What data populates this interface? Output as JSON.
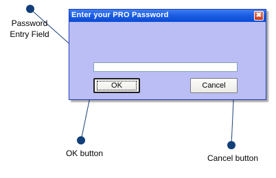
{
  "dialog": {
    "title": "Enter your PRO Password",
    "close_glyph": "✖",
    "password_value": "",
    "ok_label": "OK",
    "cancel_label": "Cancel"
  },
  "callouts": {
    "password_line1": "Password",
    "password_line2": "Entry Field",
    "ok": "OK button",
    "cancel": "Cancel button"
  },
  "colors": {
    "dialog_body": "#bbbef5",
    "titlebar": "#1d5fe3",
    "callout_dot": "#123f7a"
  }
}
